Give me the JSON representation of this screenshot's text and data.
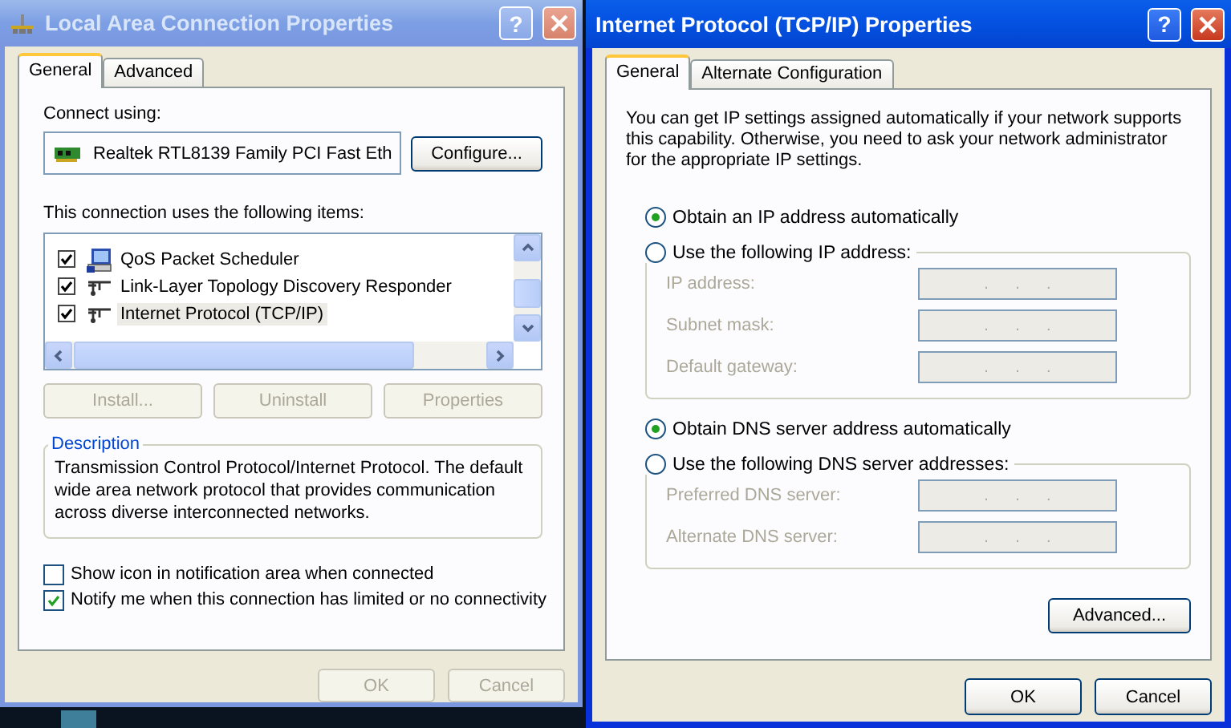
{
  "lan_window": {
    "title": "Local Area Connection Properties",
    "active": false,
    "help_button": "?",
    "tabs": [
      {
        "label": "General",
        "selected": true
      },
      {
        "label": "Advanced",
        "selected": false
      }
    ],
    "connect_using_label": "Connect using:",
    "adapter": "Realtek RTL8139 Family PCI Fast Eth",
    "configure_button": "Configure...",
    "items_label": "This connection uses the following items:",
    "items": [
      {
        "label": "QoS Packet Scheduler",
        "checked": true,
        "selected": false,
        "kind": "service"
      },
      {
        "label": "Link-Layer Topology Discovery Responder",
        "checked": true,
        "selected": false,
        "kind": "protocol"
      },
      {
        "label": "Internet Protocol (TCP/IP)",
        "checked": true,
        "selected": true,
        "kind": "protocol"
      }
    ],
    "item_buttons": [
      {
        "label": "Install...",
        "disabled": true
      },
      {
        "label": "Uninstall",
        "disabled": true
      },
      {
        "label": "Properties",
        "disabled": true
      }
    ],
    "description": {
      "title": "Description",
      "text": "Transmission Control Protocol/Internet Protocol. The default wide area network protocol that provides communication across diverse interconnected networks."
    },
    "options": [
      {
        "label": "Show icon in notification area when connected",
        "checked": false
      },
      {
        "label": "Notify me when this connection has limited or no connectivity",
        "checked": true
      }
    ],
    "buttons": [
      {
        "label": "OK",
        "disabled": true
      },
      {
        "label": "Cancel",
        "disabled": true
      }
    ]
  },
  "tcpip_window": {
    "title": "Internet Protocol (TCP/IP) Properties",
    "active": true,
    "help_button": "?",
    "tabs": [
      {
        "label": "General",
        "selected": true
      },
      {
        "label": "Alternate Configuration",
        "selected": false
      }
    ],
    "intro": "You can get IP settings assigned automatically if your network supports this capability. Otherwise, you need to ask your network administrator for the appropriate IP settings.",
    "sections": [
      {
        "auto_option": {
          "label": "Obtain an IP address automatically",
          "selected": true
        },
        "manual_option": {
          "label": "Use the following IP address:",
          "selected": false
        },
        "fields": [
          {
            "label": "IP address:",
            "value": ".      .      .",
            "disabled": true
          },
          {
            "label": "Subnet mask:",
            "value": ".      .      .",
            "disabled": true
          },
          {
            "label": "Default gateway:",
            "value": ".      .      .",
            "disabled": true
          }
        ]
      },
      {
        "auto_option": {
          "label": "Obtain DNS server address automatically",
          "selected": true
        },
        "manual_option": {
          "label": "Use the following DNS server addresses:",
          "selected": false
        },
        "fields": [
          {
            "label": "Preferred DNS server:",
            "value": ".      .      .",
            "disabled": true
          },
          {
            "label": "Alternate DNS server:",
            "value": ".      .      .",
            "disabled": true
          }
        ]
      }
    ],
    "advanced_button": "Advanced...",
    "buttons": [
      {
        "label": "OK",
        "disabled": false
      },
      {
        "label": "Cancel",
        "disabled": false
      }
    ]
  }
}
